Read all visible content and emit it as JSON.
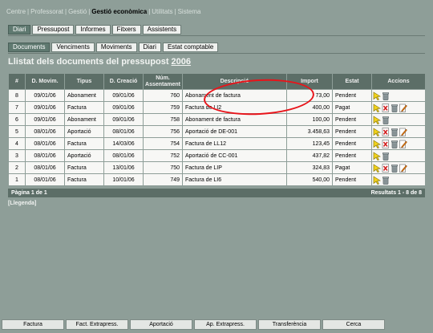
{
  "topnav": [
    {
      "label": "Centre",
      "active": false
    },
    {
      "label": "Professorat",
      "active": false
    },
    {
      "label": "Gestió",
      "active": false
    },
    {
      "label": "Gestió econòmica",
      "active": true
    },
    {
      "label": "Utilitats",
      "active": false
    },
    {
      "label": "Sistema",
      "active": false
    }
  ],
  "tabs1": [
    {
      "label": "Diari",
      "active": true
    },
    {
      "label": "Pressupost",
      "active": false
    },
    {
      "label": "Informes",
      "active": false
    },
    {
      "label": "Fitxers",
      "active": false
    },
    {
      "label": "Assistents",
      "active": false
    }
  ],
  "tabs2": [
    {
      "label": "Documents",
      "active": true
    },
    {
      "label": "Venciments",
      "active": false
    },
    {
      "label": "Moviments",
      "active": false
    },
    {
      "label": "Diari",
      "active": false
    },
    {
      "label": "Estat comptable",
      "active": false
    }
  ],
  "page_title": {
    "prefix": "Llistat dels documents del pressupost ",
    "year": "2006"
  },
  "table": {
    "headers": [
      "#",
      "D. Movim.",
      "Tipus",
      "D. Creació",
      "Núm. Assentament",
      "Descripció",
      "Import",
      "Estat",
      "Accions"
    ],
    "rows": [
      {
        "n": "8",
        "dmov": "09/01/06",
        "tipus": "Abonament",
        "dcre": "09/01/06",
        "num": "760",
        "desc": "Abonament de factura",
        "imp": "73,00",
        "estat": "Pendent",
        "delete": false,
        "edit": false
      },
      {
        "n": "7",
        "dmov": "09/01/06",
        "tipus": "Factura",
        "dcre": "09/01/06",
        "num": "759",
        "desc": "Factura de LI2",
        "imp": "400,00",
        "estat": "Pagat",
        "delete": true,
        "edit": true
      },
      {
        "n": "6",
        "dmov": "09/01/06",
        "tipus": "Abonament",
        "dcre": "09/01/06",
        "num": "758",
        "desc": "Abonament de factura",
        "imp": "100,00",
        "estat": "Pendent",
        "delete": false,
        "edit": false
      },
      {
        "n": "5",
        "dmov": "08/01/06",
        "tipus": "Aportació",
        "dcre": "08/01/06",
        "num": "756",
        "desc": "Aportació de DE-001",
        "imp": "3.458,63",
        "estat": "Pendent",
        "delete": true,
        "edit": true
      },
      {
        "n": "4",
        "dmov": "08/01/06",
        "tipus": "Factura",
        "dcre": "14/03/06",
        "num": "754",
        "desc": "Factura de LL12",
        "imp": "123,45",
        "estat": "Pendent",
        "delete": true,
        "edit": true
      },
      {
        "n": "3",
        "dmov": "08/01/06",
        "tipus": "Aportació",
        "dcre": "08/01/06",
        "num": "752",
        "desc": "Aportació de CC-001",
        "imp": "437,82",
        "estat": "Pendent",
        "delete": false,
        "edit": false
      },
      {
        "n": "2",
        "dmov": "08/01/06",
        "tipus": "Factura",
        "dcre": "13/01/06",
        "num": "750",
        "desc": "Factura de LIP",
        "imp": "324,83",
        "estat": "Pagat",
        "delete": true,
        "edit": true
      },
      {
        "n": "1",
        "dmov": "08/01/06",
        "tipus": "Factura",
        "dcre": "10/01/06",
        "num": "749",
        "desc": "Factura de LI6",
        "imp": "540,00",
        "estat": "Pendent",
        "delete": false,
        "edit": false
      }
    ]
  },
  "footer": {
    "page": "Pàgina 1 de 1",
    "results": "Resultats 1 - 8 de 8"
  },
  "legend": "[Llegenda]",
  "bottom_buttons": [
    "Factura",
    "Fact. Extrapress.",
    "Aportació",
    "Ap. Extrapress.",
    "Transferència",
    "Cerca"
  ],
  "colors": {
    "background": "#8e9e98",
    "header": "#5c6e67",
    "active_tab": "#5f7970",
    "highlight": "#e8141a"
  },
  "icons": {
    "view": "arrow-cursor-icon",
    "trash": "trash-icon",
    "delete": "delete-document-icon",
    "edit": "edit-pencil-icon"
  }
}
